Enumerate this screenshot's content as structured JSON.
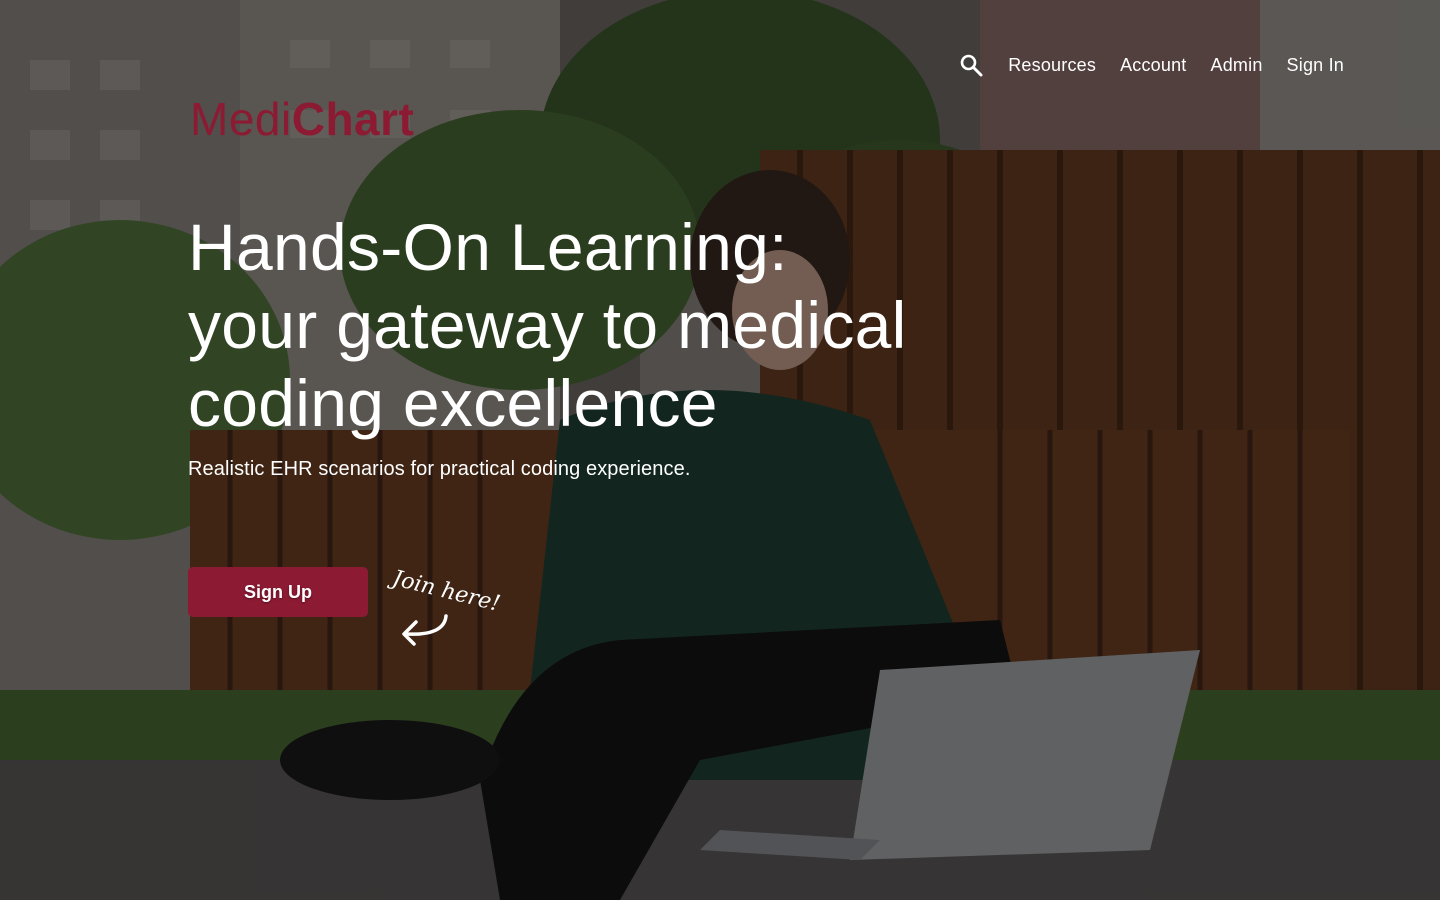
{
  "brand": {
    "name_part1": "Medi",
    "name_part2": "Chart",
    "color": "#8c1a33"
  },
  "nav": {
    "search_icon": "search-icon",
    "items": [
      {
        "label": "Resources"
      },
      {
        "label": "Account"
      },
      {
        "label": "Admin"
      },
      {
        "label": "Sign In"
      }
    ]
  },
  "hero": {
    "title_lines": [
      "Hands-On Learning:",
      "your gateway to medical",
      "coding excellence"
    ],
    "subtitle": "Realistic EHR scenarios for practical coding experience.",
    "cta_label": "Sign Up",
    "cta_color": "#8c1a33",
    "join_note": "Join here!",
    "join_arrow_icon": "curved-arrow-icon"
  }
}
